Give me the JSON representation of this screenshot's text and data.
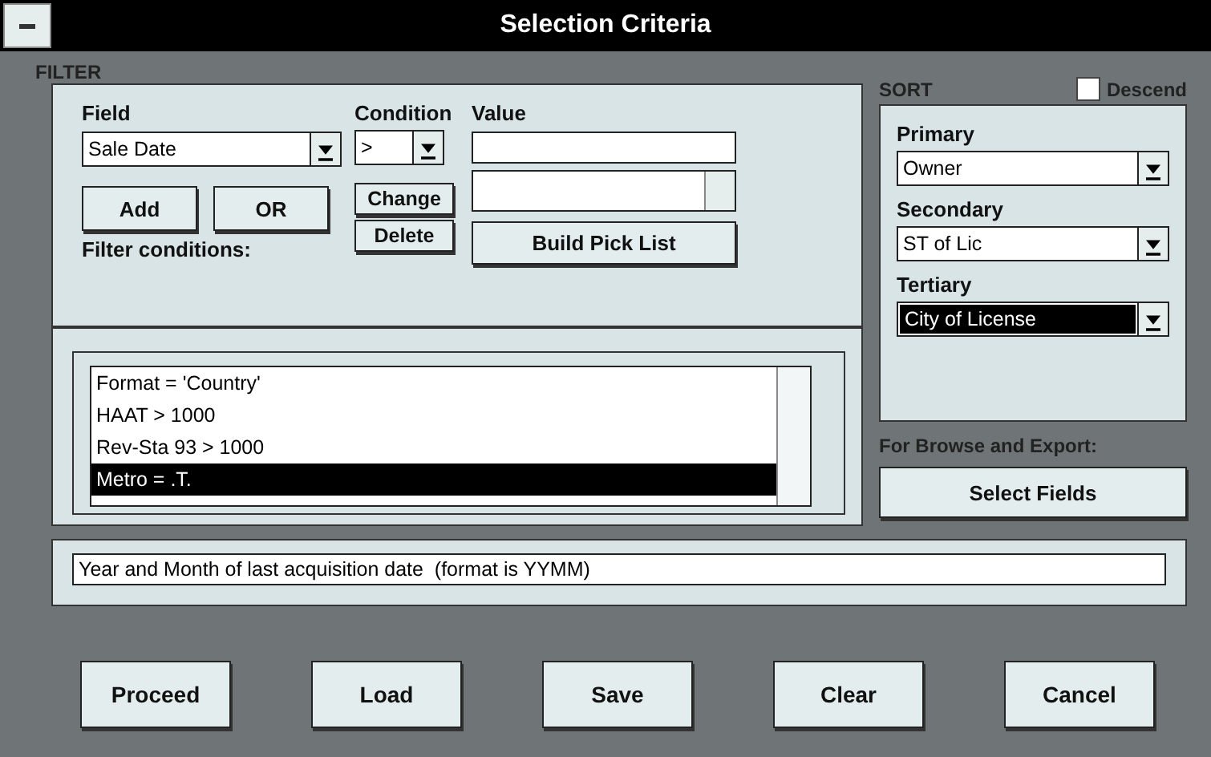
{
  "window": {
    "title": "Selection Criteria"
  },
  "filter": {
    "heading": "FILTER",
    "field": {
      "label": "Field",
      "value": "Sale Date"
    },
    "condition": {
      "label": "Condition",
      "value": ">"
    },
    "value": {
      "label": "Value"
    },
    "buttons": [
      {
        "label": "Add"
      },
      {
        "label": "OR"
      }
    ],
    "edit_buttons": [
      {
        "label": "Change"
      },
      {
        "label": "Delete"
      }
    ],
    "pick_list_button": "Build Pick List",
    "conditions_label": "Filter conditions:",
    "conditions": [
      {
        "text": "Format = 'Country'",
        "selected": false
      },
      {
        "text": "HAAT > 1000",
        "selected": false
      },
      {
        "text": "Rev-Sta 93 > 1000",
        "selected": false
      },
      {
        "text": "Metro = .T.",
        "selected": true
      }
    ]
  },
  "sort": {
    "heading": "SORT",
    "descend": {
      "label": "Descend",
      "checked": false
    },
    "levels": [
      {
        "label": "Primary",
        "value": "Owner",
        "selected": false
      },
      {
        "label": "Secondary",
        "value": "ST of Lic",
        "selected": false
      },
      {
        "label": "Tertiary",
        "value": "City of License",
        "selected": true
      }
    ],
    "export_label": "For Browse and Export:",
    "select_fields_button": "Select Fields"
  },
  "status": "Year and Month of last acquisition date  (format is YYMM)",
  "buttons": [
    "Proceed",
    "Load",
    "Save",
    "Clear",
    "Cancel"
  ]
}
